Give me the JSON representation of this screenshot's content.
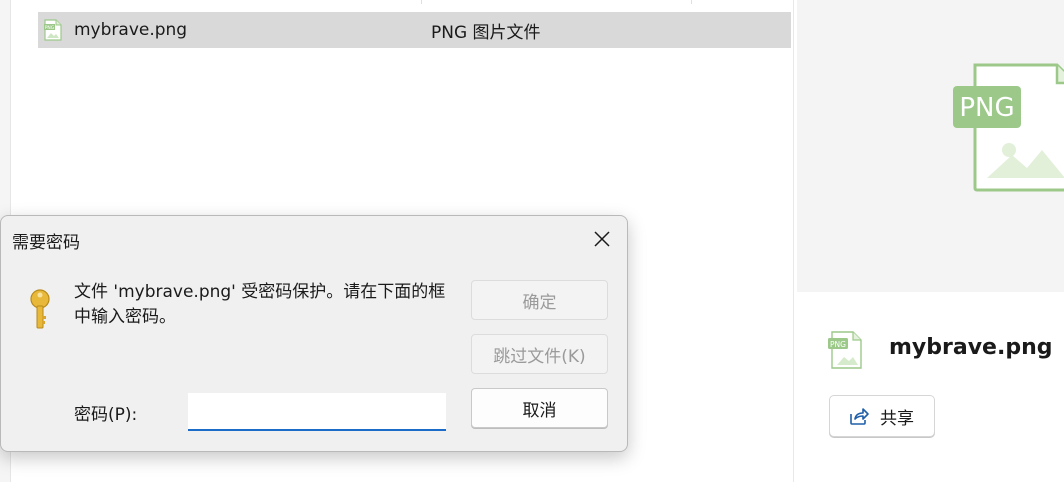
{
  "file_list": {
    "rows": [
      {
        "name": "mybrave.png",
        "type": "PNG 图片文件",
        "icon": "png-file-icon"
      }
    ]
  },
  "preview": {
    "big_icon_label": "PNG",
    "file_name": "mybrave.png",
    "share_label": "共享",
    "share_icon": "share-icon"
  },
  "dialog": {
    "title": "需要密码",
    "message": "文件 'mybrave.png' 受密码保护。请在下面的框中输入密码。",
    "icon": "key-icon",
    "ok_label": "确定",
    "skip_label": "跳过文件(K)",
    "cancel_label": "取消",
    "password_label": "密码(P):",
    "password_value": ""
  },
  "colors": {
    "selection": "#d9d9d9",
    "png_green": "#9cc98a",
    "accent": "#1a6cc8"
  }
}
